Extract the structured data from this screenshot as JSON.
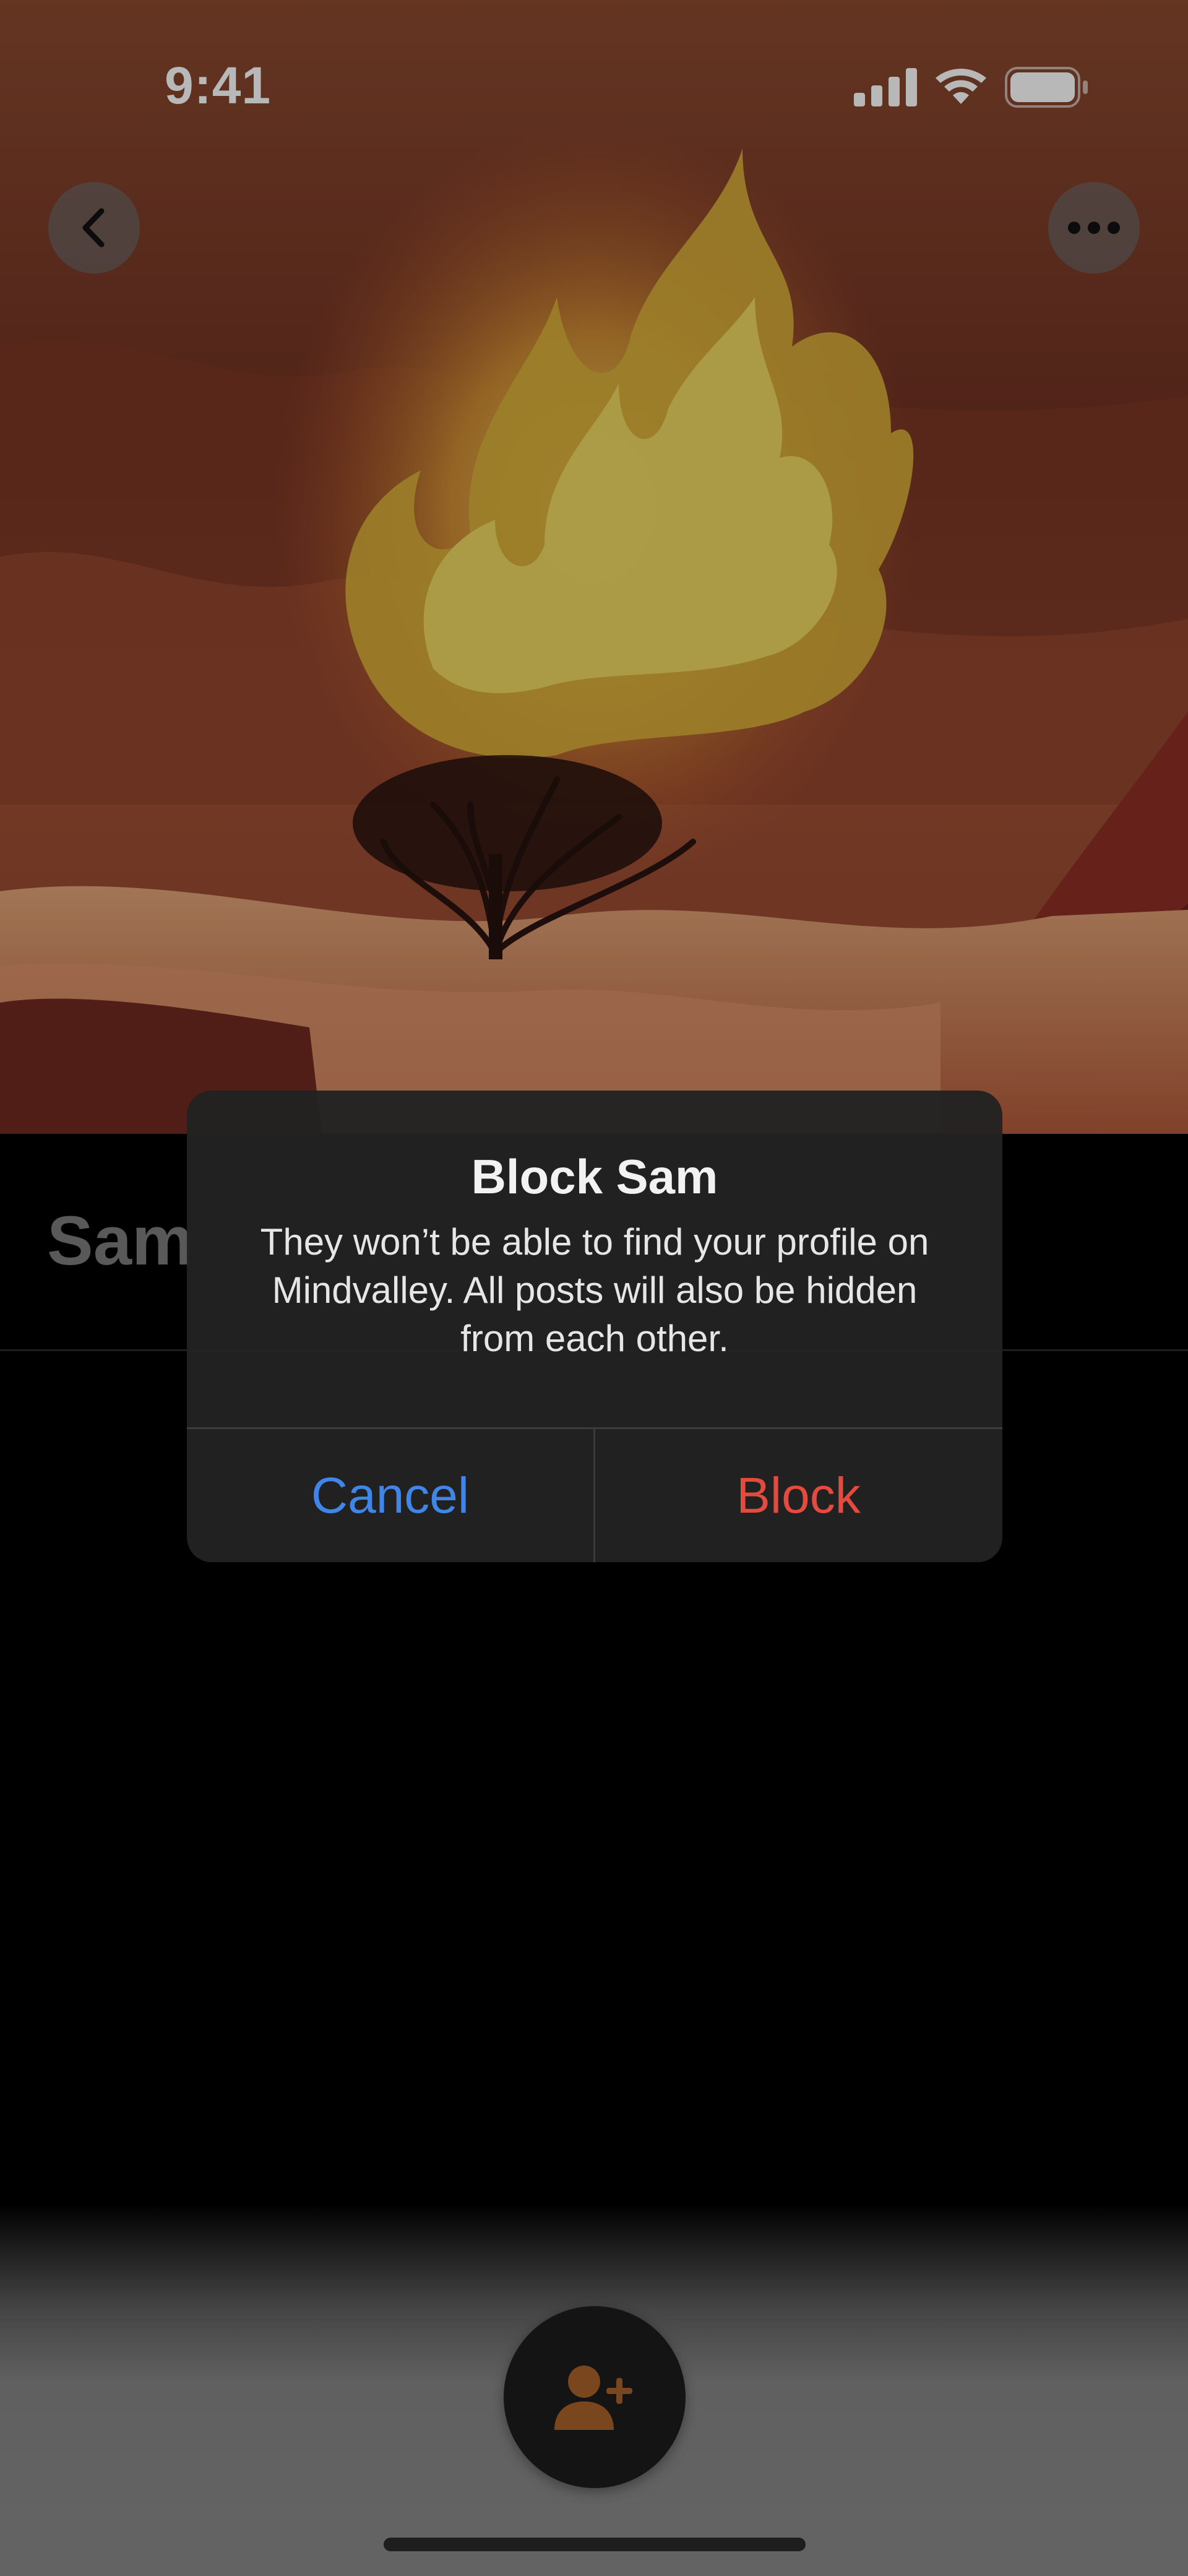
{
  "status_bar": {
    "time": "9:41"
  },
  "top_bar": {
    "back_icon": "chevron-left-icon",
    "more_icon": "ellipsis-icon"
  },
  "profile": {
    "name_partial": "Sam"
  },
  "alert": {
    "title": "Block Sam",
    "message": "They won’t be able to find your profile on Mindvalley. All posts will also be hidden from each other.",
    "cancel_label": "Cancel",
    "block_label": "Block"
  },
  "fab": {
    "icon": "add-friend-icon"
  },
  "colors": {
    "cancel": "#3f86e8",
    "destructive": "#e44a3e",
    "fab_icon": "#a8622a"
  }
}
